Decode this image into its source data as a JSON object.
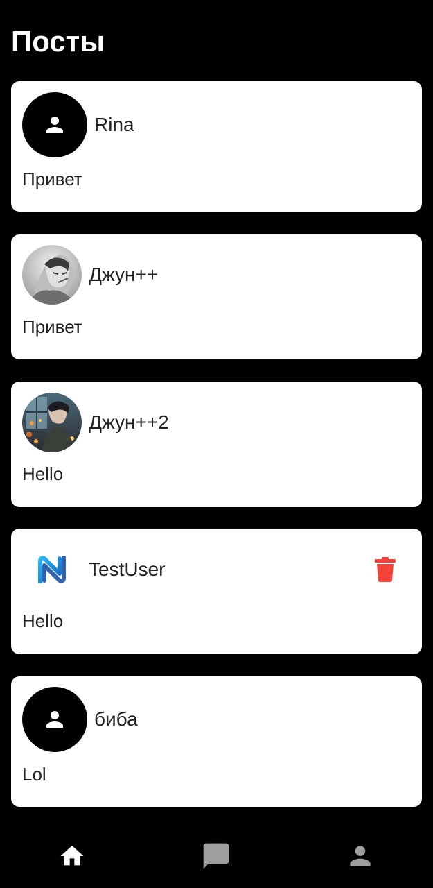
{
  "header": {
    "title": "Посты"
  },
  "posts": [
    {
      "username": "Rina",
      "text": "Привет",
      "avatar": "default-person"
    },
    {
      "username": "Джун++",
      "text": "Привет",
      "avatar": "grayscale-anime-photo"
    },
    {
      "username": "Джун++2",
      "text": "Hello",
      "avatar": "anime-window-photo"
    },
    {
      "username": "TestUser",
      "text": "Hello",
      "avatar": "n-logo",
      "delete_icon": "trash-icon"
    },
    {
      "username": "биба",
      "text": "Lol",
      "avatar": "default-person"
    }
  ],
  "colors": {
    "background": "#000000",
    "card": "#ffffff",
    "delete": "#f44336",
    "nav_active": "#ffffff",
    "nav_inactive": "#9e9e9e"
  },
  "nav": {
    "items": [
      {
        "icon": "home-icon",
        "active": true
      },
      {
        "icon": "chat-icon",
        "active": false
      },
      {
        "icon": "person-icon",
        "active": false
      }
    ]
  }
}
